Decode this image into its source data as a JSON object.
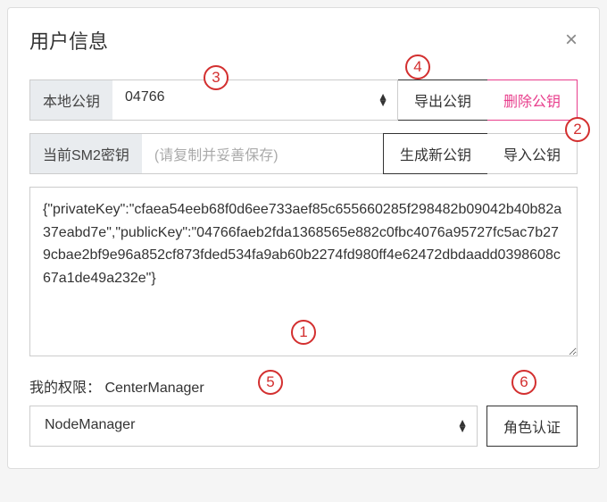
{
  "modal": {
    "title": "用户信息",
    "close": "×"
  },
  "row1": {
    "label": "本地公钥",
    "select_value": "04766",
    "export_btn": "导出公钥",
    "delete_btn": "删除公钥"
  },
  "row2": {
    "label": "当前SM2密钥",
    "placeholder": "(请复制并妥善保存)",
    "generate_btn": "生成新公钥",
    "import_btn": "导入公钥"
  },
  "key_json": "{\"privateKey\":\"cfaea54eeb68f0d6ee733aef85c655660285f298482b09042b40b82a37eabd7e\",\"publicKey\":\"04766faeb2fda1368565e882c0fbc4076a95727fc5ac7b279cbae2bf9e96a852cf873fded534fa9ab60b2274fd980ff4e62472dbdaadd0398608c67a1de49a232e\"}",
  "permissions": {
    "label": "我的权限：",
    "value": "CenterManager",
    "select_value": "NodeManager",
    "auth_btn": "角色认证"
  },
  "annotations": {
    "a1": "1",
    "a2": "2",
    "a3": "3",
    "a4": "4",
    "a5": "5",
    "a6": "6"
  }
}
